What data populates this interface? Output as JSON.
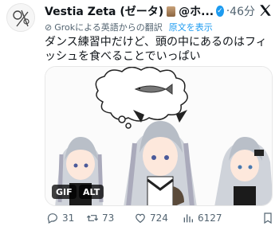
{
  "tweet": {
    "name": "Vestia Zeta (ゼータ)",
    "handle": "@ホ...",
    "time": "46分",
    "translate_note": "Grokによる英語からの翻訳",
    "translate_original": "原文を表示",
    "text": "ダンス練習中だけど、頭の中にあるのはフィッシュを食べることでいっぱい"
  },
  "media": {
    "gif_label": "GIF",
    "alt_label": "ALT"
  },
  "actions": {
    "replies": "31",
    "retweets": "73",
    "likes": "724",
    "views": "6127"
  },
  "icons": {
    "verified": "verified-badge-icon",
    "x_logo": "x-logo-icon",
    "reply": "reply-icon",
    "retweet": "retweet-icon",
    "like": "heart-icon",
    "views": "views-chart-icon",
    "bookmark": "bookmark-icon"
  },
  "colors": {
    "accent": "#1d9bf0",
    "text": "#0f1419",
    "muted": "#536471"
  }
}
